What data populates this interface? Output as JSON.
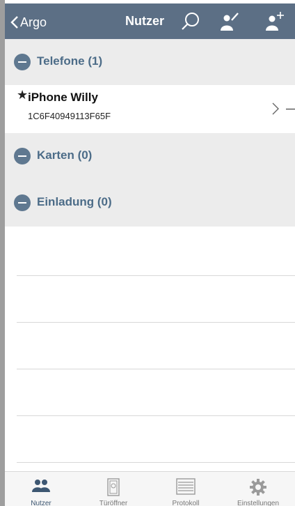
{
  "navbar": {
    "back_label": "Argo",
    "title": "Nutzer",
    "icons": [
      "chevron-left-icon",
      "search-icon",
      "edit-user-icon",
      "add-user-icon"
    ]
  },
  "sections": [
    {
      "label": "Telefone (1)"
    },
    {
      "label": "Karten (0)"
    },
    {
      "label": "Einladung (0)"
    }
  ],
  "phone": {
    "name": "iPhone Willy",
    "id": "1C6F40949113F65F",
    "starred": true
  },
  "tabs": [
    {
      "label": "Nutzer",
      "icon": "users-icon",
      "active": true
    },
    {
      "label": "Türöffner",
      "icon": "door-icon",
      "active": false
    },
    {
      "label": "Protokoll",
      "icon": "list-icon",
      "active": false
    },
    {
      "label": "Einstellungen",
      "icon": "gear-icon",
      "active": false
    }
  ],
  "colors": {
    "navbar": "#5c6f85",
    "section_bg": "#ececec",
    "accent": "#4c6c88",
    "icon_blue": "#5f7890"
  }
}
